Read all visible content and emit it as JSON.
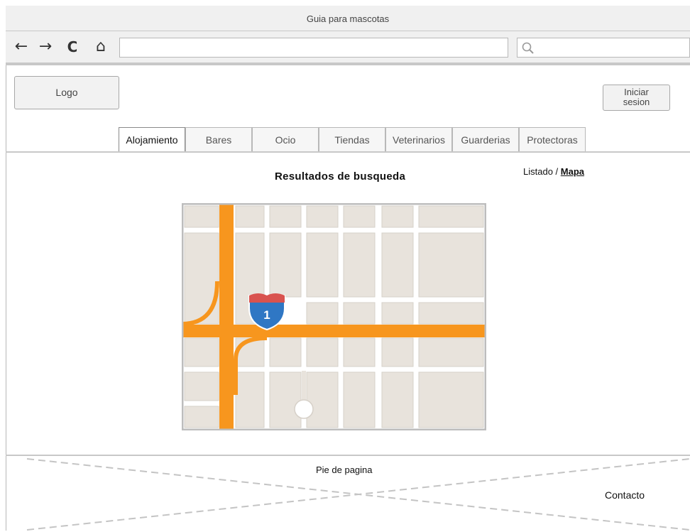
{
  "window": {
    "title": "Guia para mascotas"
  },
  "browser": {
    "back_icon": "←",
    "forward_icon": "→",
    "reload_icon": "C",
    "home_icon": "⌂",
    "url": "",
    "search_value": ""
  },
  "header": {
    "logo_label": "Logo",
    "login_label_line1": "Iniciar",
    "login_label_line2": "sesion"
  },
  "tabs": [
    {
      "label": "Alojamiento",
      "active": true
    },
    {
      "label": "Bares",
      "active": false
    },
    {
      "label": "Ocio",
      "active": false
    },
    {
      "label": "Tiendas",
      "active": false
    },
    {
      "label": "Veterinarios",
      "active": false
    },
    {
      "label": "Guarderias",
      "active": false
    },
    {
      "label": "Protectoras",
      "active": false
    }
  ],
  "main": {
    "results_title": "Resultados de busqueda",
    "view_list": "Listado /",
    "view_map": "Mapa",
    "map_shield_number": "1"
  },
  "footer": {
    "title": "Pie de pagina",
    "contact": "Contacto"
  },
  "colors": {
    "road": "#f7961e",
    "block": "#e8e3dc",
    "shield_blue": "#2f77c4",
    "shield_red": "#d9534f"
  }
}
